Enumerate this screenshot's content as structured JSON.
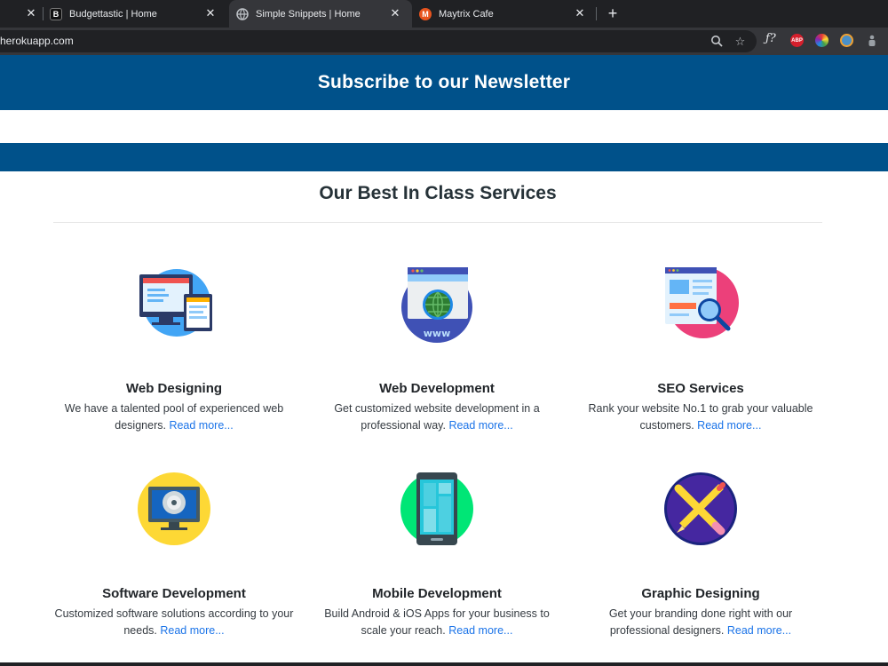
{
  "browser": {
    "tabs": [
      {
        "title": "",
        "favicon": "none"
      },
      {
        "title": "Budgettastic | Home",
        "favicon": "B"
      },
      {
        "title": "Simple Snippets | Home",
        "favicon": "globe-icon"
      },
      {
        "title": "Maytrix Cafe",
        "favicon": "M"
      }
    ],
    "url": "herokuapp.com",
    "extensions": {
      "adblock": "ABP"
    }
  },
  "newsletter": {
    "title": "Subscribe to our Newsletter"
  },
  "services": {
    "title": "Our Best In Class Services",
    "read_more": "Read more...",
    "items": [
      {
        "title": "Web Designing",
        "desc": "We have a talented pool of experienced web designers.",
        "icon": "web-designing-icon"
      },
      {
        "title": "Web Development",
        "desc": "Get customized website development in a professional way.",
        "icon": "web-development-icon"
      },
      {
        "title": "SEO Services",
        "desc": "Rank your website No.1 to grab your valuable customers.",
        "icon": "seo-services-icon"
      },
      {
        "title": "Software Development",
        "desc": "Customized software solutions according to your needs.",
        "icon": "software-development-icon"
      },
      {
        "title": "Mobile Development",
        "desc": "Build Android & iOS Apps for your business to scale your reach.",
        "icon": "mobile-development-icon"
      },
      {
        "title": "Graphic Designing",
        "desc": "Get your branding done right with our professional designers.",
        "icon": "graphic-designing-icon"
      }
    ]
  },
  "colors": {
    "brand_blue": "#00518a",
    "link": "#1a73e8"
  }
}
